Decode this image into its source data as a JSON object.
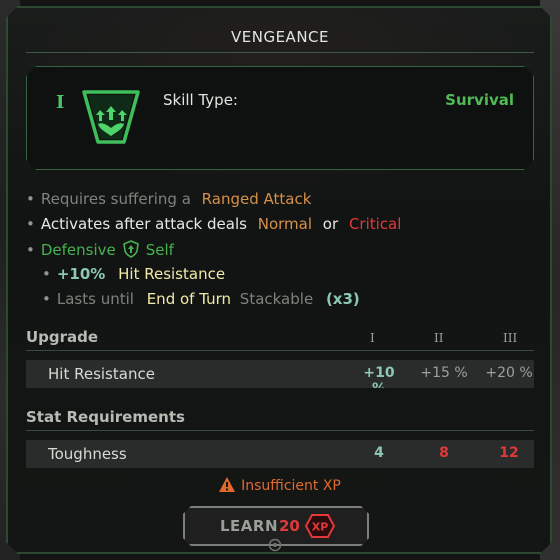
{
  "title": "VENGEANCE",
  "skill": {
    "rank": "I",
    "type_label": "Skill Type:",
    "type_value": "Survival",
    "icon": "survival-skill-icon"
  },
  "effects": {
    "line1": {
      "prefix": "Requires suffering a",
      "value": "Ranged Attack"
    },
    "line2": {
      "prefix": "Activates after attack deals",
      "normal": "Normal",
      "or": "or",
      "critical": "Critical"
    },
    "line3": {
      "defensive": "Defensive",
      "self": "Self",
      "icon": "defensive-shield-icon"
    },
    "line4": {
      "amount": "+10%",
      "stat": "Hit Resistance"
    },
    "line5": {
      "prefix": "Lasts until",
      "value": "End of Turn",
      "stackable": "Stackable",
      "count": "(x3)"
    }
  },
  "upgrade": {
    "header": "Upgrade",
    "tiers": [
      "I",
      "II",
      "III"
    ],
    "row_label": "Hit Resistance",
    "values": [
      "+10 %",
      "+15 %",
      "+20 %"
    ]
  },
  "requirements": {
    "header": "Stat Requirements",
    "row_label": "Toughness",
    "values": [
      "4",
      "8",
      "12"
    ]
  },
  "warning": "Insufficient XP",
  "learn": {
    "label": "LEARN",
    "cost": "20",
    "currency": "XP"
  },
  "colors": {
    "accent_green": "#46b24f",
    "orange": "#d6904a",
    "red": "#e0393a",
    "border_green": "#35623f"
  }
}
